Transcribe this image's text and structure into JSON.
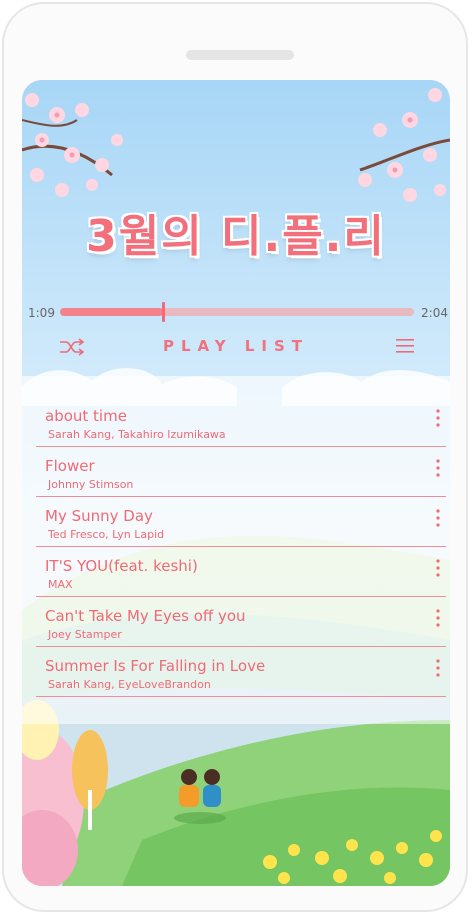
{
  "app": {
    "title": "3월의 디.플.리"
  },
  "player": {
    "current_time": "1:09",
    "total_time": "2:04",
    "progress": 0.29
  },
  "controls": {
    "shuffle_icon": "shuffle-icon",
    "playlist_label": "PLAY LIST",
    "menu_icon": "menu-icon"
  },
  "playlist": [
    {
      "title": "about time",
      "artist": "Sarah Kang, Takahiro Izumikawa"
    },
    {
      "title": "Flower",
      "artist": "Johnny Stimson"
    },
    {
      "title": "My Sunny Day",
      "artist": "Ted Fresco, Lyn Lapid"
    },
    {
      "title": "IT'S YOU(feat. keshi)",
      "artist": "MAX"
    },
    {
      "title": "Can't Take My Eyes off you",
      "artist": "Joey Stamper"
    },
    {
      "title": "Summer Is For Falling in Love",
      "artist": "Sarah Kang, EyeLoveBrandon"
    }
  ],
  "colors": {
    "accent": "#f06a76",
    "progress_track": "#e9b9c1",
    "sky": "#a7d6f6",
    "grass": "#7cc96a"
  }
}
